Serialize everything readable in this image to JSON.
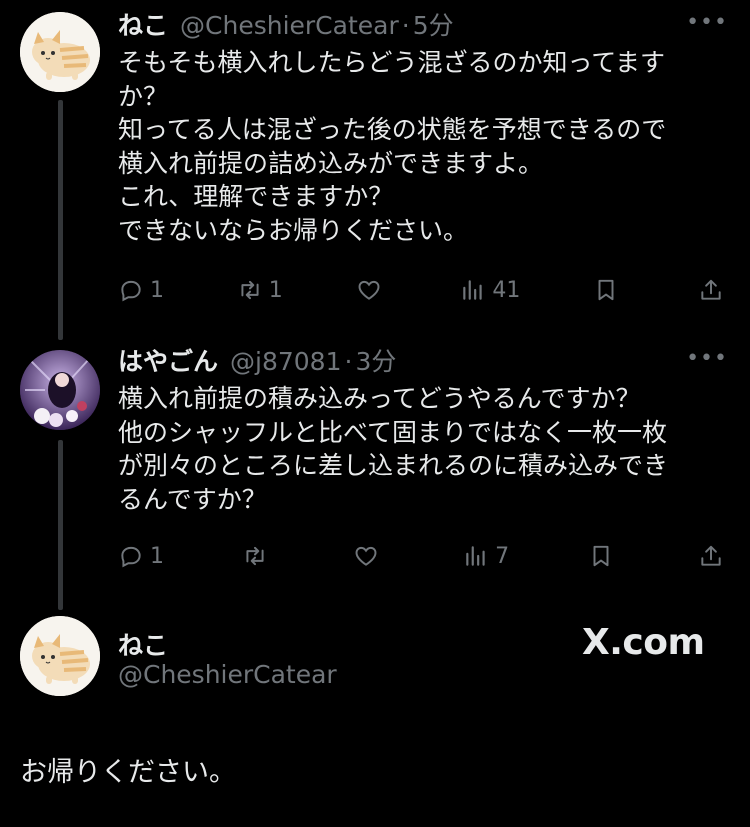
{
  "tweets": [
    {
      "name": "ねこ",
      "handle": "@CheshierCatear",
      "time": "5分",
      "lines": [
        "そもそも横入れしたらどう混ざるのか知ってます",
        "か？",
        "知ってる人は混ざった後の状態を予想できるので",
        "横入れ前提の詰め込みができますよ。",
        "これ、理解できますか？",
        "できないならお帰りください。"
      ],
      "replies": "1",
      "retweets": "1",
      "likes": "",
      "views": "41"
    },
    {
      "name": "はやごん",
      "handle": "@j87081",
      "time": "3分",
      "lines": [
        "横入れ前提の積み込みってどうやるんですか？",
        "他のシャッフルと比べて固まりではなく一枚一枚",
        "が別々のところに差し込まれるのに積み込みでき",
        "るんですか？"
      ],
      "replies": "1",
      "retweets": "",
      "likes": "",
      "views": "7"
    }
  ],
  "quoted": {
    "name": "ねこ",
    "handle": "@CheshierCatear",
    "text": "お帰りください。"
  },
  "watermark": "X.com",
  "icons": {
    "reply": "reply-icon",
    "retweet": "retweet-icon",
    "like": "heart-icon",
    "views": "views-icon",
    "bookmark": "bookmark-icon",
    "share": "share-icon",
    "more": "more-icon"
  }
}
